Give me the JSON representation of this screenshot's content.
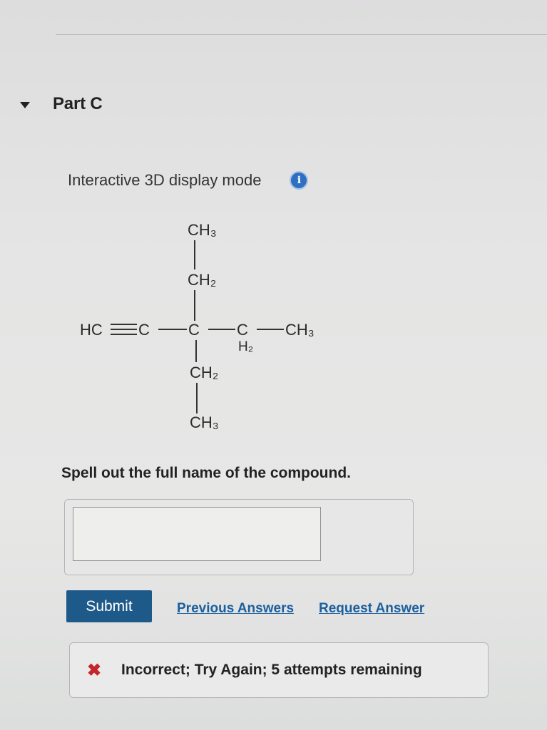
{
  "part": {
    "title": "Part C"
  },
  "display": {
    "mode_label": "Interactive 3D display mode",
    "info_icon_glyph": "i"
  },
  "molecule": {
    "top_chain": [
      "CH3",
      "CH2"
    ],
    "main_chain": [
      "HC",
      "C",
      "C",
      "C",
      "CH3"
    ],
    "main_chain_sub": "H2",
    "bottom_chain": [
      "CH2",
      "CH3"
    ]
  },
  "question": {
    "prompt": "Spell out the full name of the compound.",
    "answer_value": ""
  },
  "actions": {
    "submit_label": "Submit",
    "previous_answers_label": "Previous Answers",
    "request_answer_label": "Request Answer"
  },
  "feedback": {
    "icon": "x-icon",
    "text": "Incorrect; Try Again; 5 attempts remaining",
    "color": "#c3262b"
  },
  "colors": {
    "accent": "#1d5a8a",
    "link": "#1c5f9e",
    "info": "#2f6fc2"
  }
}
